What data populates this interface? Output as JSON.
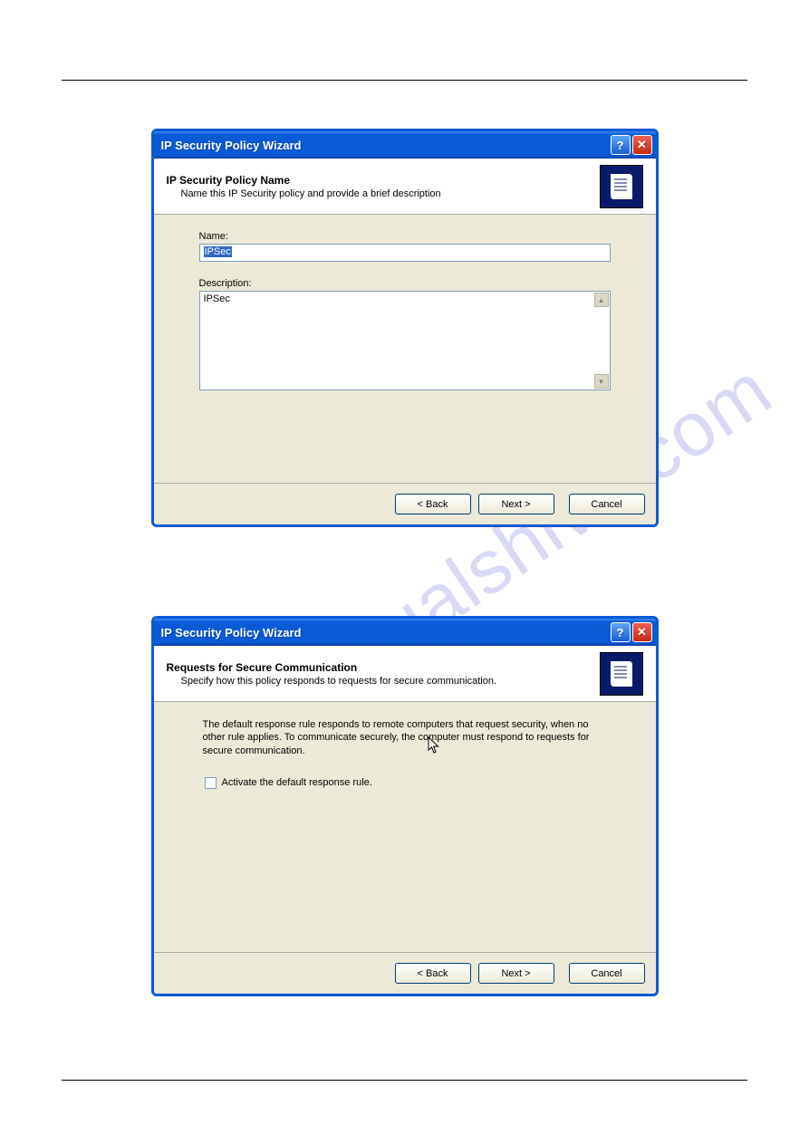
{
  "watermark": "manualshive.com",
  "dialog1": {
    "title": "IP Security Policy Wizard",
    "header_title": "IP Security Policy Name",
    "header_sub": "Name this IP Security policy and provide a brief description",
    "name_label": "Name:",
    "name_value": "IPSec",
    "desc_label": "Description:",
    "desc_value": "IPSec",
    "buttons": {
      "back": "< Back",
      "next": "Next >",
      "cancel": "Cancel"
    }
  },
  "dialog2": {
    "title": "IP Security Policy Wizard",
    "header_title": "Requests for Secure Communication",
    "header_sub": "Specify how this policy responds to requests for secure communication.",
    "explain": "The default response rule responds to remote computers that request security, when no other rule applies. To communicate securely, the computer must respond to requests for secure communication.",
    "check_label": "Activate the default response rule.",
    "checked": false,
    "buttons": {
      "back": "< Back",
      "next": "Next >",
      "cancel": "Cancel"
    }
  }
}
